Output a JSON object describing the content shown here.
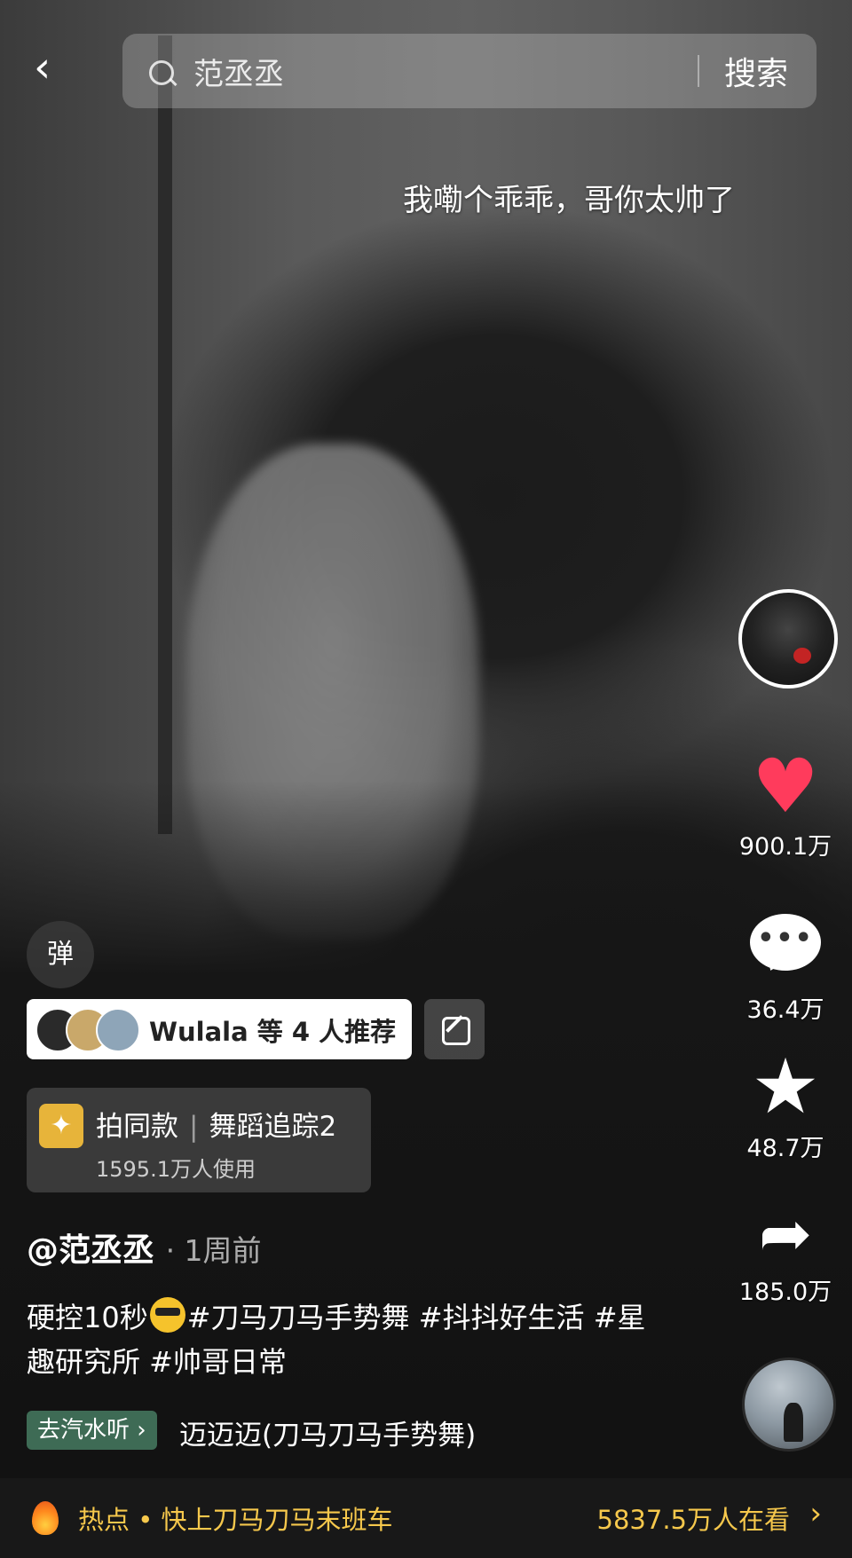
{
  "search": {
    "query": "范丞丞",
    "button": "搜索"
  },
  "danmu_comment": "我嘞个乖乖，哥你太帅了",
  "actions": {
    "likes": "900.1万",
    "comments": "36.4万",
    "favorites": "48.7万",
    "shares": "185.0万"
  },
  "danmu_toggle": "弹",
  "recommend": {
    "text": "Wulala 等 4 人推荐"
  },
  "effect": {
    "title": "拍同款",
    "name": "舞蹈追踪2",
    "usage": "1595.1万人使用"
  },
  "post": {
    "author": "@范丞丞",
    "time": "1周前",
    "caption_before_emoji": "硬控10秒",
    "caption_after_emoji": "#刀马刀马手势舞 #抖抖好生活 #星趣研究所 #帅哥日常"
  },
  "music": {
    "tag": "去汽水听 ›",
    "title": "迈迈迈(刀马刀马手势舞)"
  },
  "hot": {
    "label": "热点 • 快上刀马刀马末班车",
    "count": "5837.5万人在看",
    "arrow": "›"
  },
  "colors": {
    "like": "#ff3b5c",
    "hot": "#f6c84c",
    "music_tag": "#3e6b55"
  }
}
